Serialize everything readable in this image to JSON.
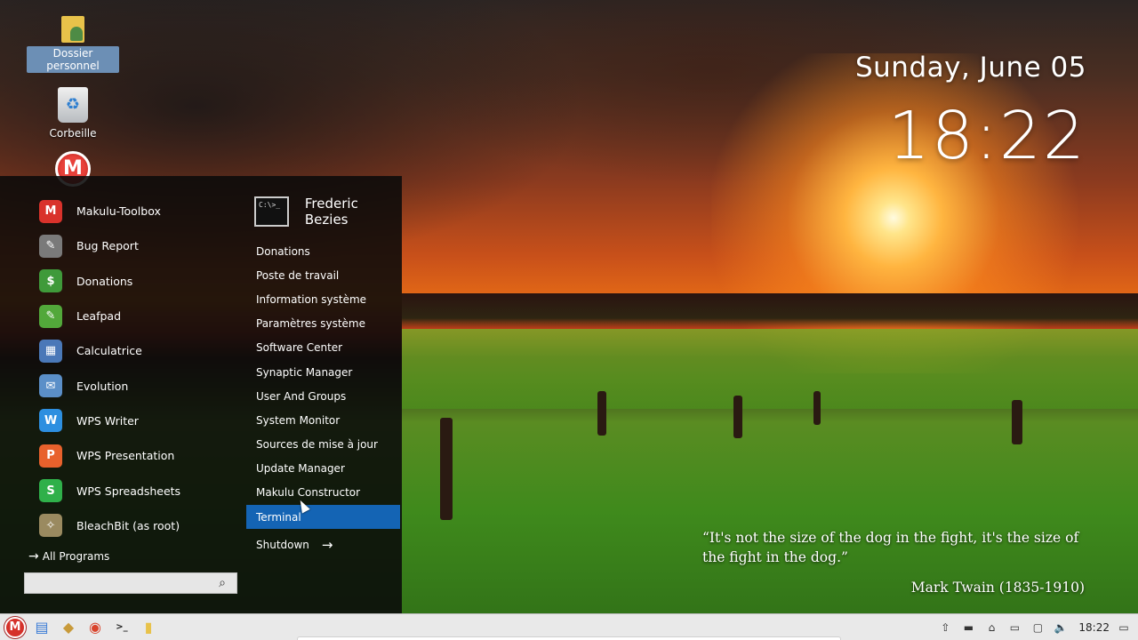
{
  "desktop": {
    "icons": [
      {
        "label": "Dossier personnel",
        "icon": "home-folder-icon"
      },
      {
        "label": "Corbeille",
        "icon": "trash-icon"
      }
    ]
  },
  "clock_widget": {
    "date": "Sunday, June 05",
    "time": "18:22"
  },
  "quote_widget": {
    "text": "“It's not the size of the dog in the fight, it's the size of the fight in the dog.”",
    "author": "Mark Twain (1835-1910)"
  },
  "start_menu": {
    "favorites": [
      {
        "label": "Makulu-Toolbox",
        "icon": "makulu-icon",
        "color": "#d9322b",
        "glyph": "M"
      },
      {
        "label": "Bug Report",
        "icon": "bug-report-icon",
        "color": "#7a7a7a",
        "glyph": "✎"
      },
      {
        "label": "Donations",
        "icon": "donations-icon",
        "color": "#3f9a3a",
        "glyph": "$"
      },
      {
        "label": "Leafpad",
        "icon": "leafpad-icon",
        "color": "#52a83a",
        "glyph": "✎"
      },
      {
        "label": "Calculatrice",
        "icon": "calculator-icon",
        "color": "#4a78b8",
        "glyph": "▦"
      },
      {
        "label": "Evolution",
        "icon": "evolution-icon",
        "color": "#5b8fc8",
        "glyph": "✉"
      },
      {
        "label": "WPS Writer",
        "icon": "wps-writer-icon",
        "color": "#2d8fe0",
        "glyph": "W"
      },
      {
        "label": "WPS Presentation",
        "icon": "wps-presentation-icon",
        "color": "#e8612c",
        "glyph": "P"
      },
      {
        "label": "WPS Spreadsheets",
        "icon": "wps-spreadsheets-icon",
        "color": "#2fb04a",
        "glyph": "S"
      },
      {
        "label": "BleachBit (as root)",
        "icon": "bleachbit-icon",
        "color": "#9a8a60",
        "glyph": "✧"
      }
    ],
    "all_programs_label": "All Programs",
    "search_placeholder": "",
    "user_name": "Frederic Bezies",
    "avatar_text": "C:\\>_",
    "system_items": [
      {
        "label": "Donations"
      },
      {
        "label": "Poste de travail"
      },
      {
        "label": "Information système"
      },
      {
        "label": "Paramètres système"
      },
      {
        "label": "Software Center"
      },
      {
        "label": "Synaptic Manager"
      },
      {
        "label": "User And Groups"
      },
      {
        "label": "System Monitor"
      },
      {
        "label": "Sources de mise à jour"
      },
      {
        "label": "Update Manager"
      },
      {
        "label": "Makulu Constructor"
      },
      {
        "label": "Terminal",
        "active": true
      }
    ],
    "shutdown_label": "Shutdown"
  },
  "taskbar": {
    "launchers": [
      {
        "icon": "file-manager-icon",
        "glyph": "▤",
        "color": "#3a7bd5"
      },
      {
        "icon": "software-icon",
        "glyph": "◆",
        "color": "#c89a3a"
      },
      {
        "icon": "chrome-icon",
        "glyph": "◉",
        "color": "#d9442c"
      },
      {
        "icon": "terminal-icon",
        "glyph": ">_",
        "color": "#222222"
      },
      {
        "icon": "folder-icon",
        "glyph": "▮",
        "color": "#e8c24a"
      }
    ],
    "tray": [
      {
        "icon": "update-icon",
        "glyph": "⇧"
      },
      {
        "icon": "battery-icon",
        "glyph": "▬"
      },
      {
        "icon": "network-icon",
        "glyph": "⌂"
      },
      {
        "icon": "drive-icon",
        "glyph": "▭"
      },
      {
        "icon": "display-icon",
        "glyph": "▢"
      },
      {
        "icon": "volume-icon",
        "glyph": "🔈"
      }
    ],
    "clock": "18:22"
  }
}
